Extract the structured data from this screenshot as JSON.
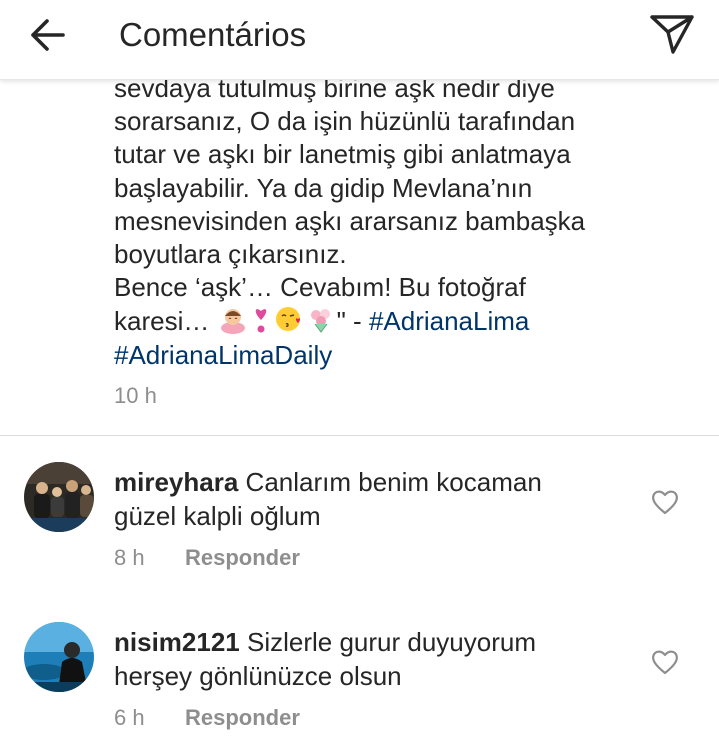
{
  "header": {
    "title": "Comentários",
    "back_icon": "arrow-left-icon",
    "share_icon": "send-direct-icon"
  },
  "caption": {
    "line1": "sevdaya tutulmuş birine aşk nedir diye",
    "line2": "sorarsanız, O da işin hüzünlü tarafından",
    "line3": "tutar ve aşkı bir lanetmiş gibi anlatmaya",
    "line4": "başlayabilir. Ya da gidip Mevlana’nın",
    "line5": "mesnevisinden aşkı ararsanız bambaşka",
    "line6": "boyutlara çıkarsınız.",
    "line7": "Bence ‘aşk’… Cevabım! Bu fotoğraf",
    "line8_prefix": "karesi…",
    "line8_suffix": "\" - ",
    "hashtag1": "#AdrianaLima",
    "hashtag2": "#AdrianaLimaDaily",
    "emojis": [
      "person-bowing-emoji",
      "heart-exclamation-emoji",
      "face-blowing-kiss-emoji",
      "bouquet-emoji"
    ],
    "time": "10 h"
  },
  "comments": [
    {
      "username": "mireyhara",
      "text_line1": "Canlarım benim kocaman",
      "text_line2": "güzel kalpli oğlum",
      "time": "8 h",
      "reply": "Responder"
    },
    {
      "username": "nisim2121",
      "text_line1": "Sizlerle gurur duyuyorum",
      "text_line2": "herşey gönlünüzce olsun",
      "time": "6 h",
      "reply": "Responder"
    }
  ],
  "colors": {
    "text": "#262626",
    "muted": "#8e8e8e",
    "hashtag": "#003569",
    "divider": "#dbdbdb"
  }
}
